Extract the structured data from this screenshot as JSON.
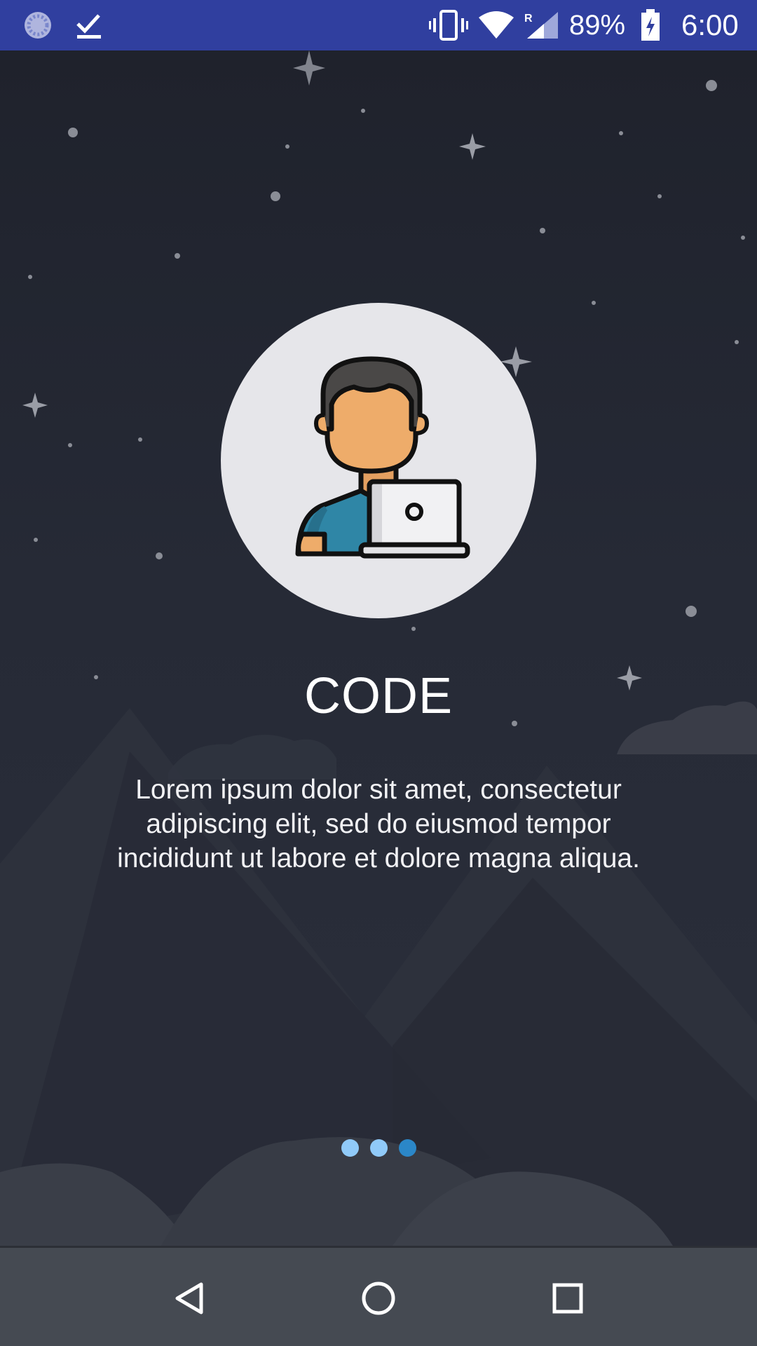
{
  "status_bar": {
    "battery_percent": "89%",
    "time": "6:00",
    "bg_color": "#303F9F",
    "icons": [
      "loading-icon",
      "checkmark-icon",
      "vibrate-icon",
      "wifi-icon",
      "signal-icon",
      "battery-charging-icon"
    ],
    "roaming_label": "R"
  },
  "slide": {
    "title": "CODE",
    "description": "Lorem ipsum dolor sit amet, consectetur adipiscing elit, sed do eiusmod tempor incididunt ut labore et dolore magna aliqua.",
    "illustration": "developer-laptop-icon"
  },
  "pager": {
    "count": 3,
    "active_index": 2,
    "dot_color": "#90caf9",
    "active_color": "#2b87c8"
  },
  "nav_bar": {
    "buttons": [
      "back-icon",
      "home-icon",
      "recents-icon"
    ]
  }
}
